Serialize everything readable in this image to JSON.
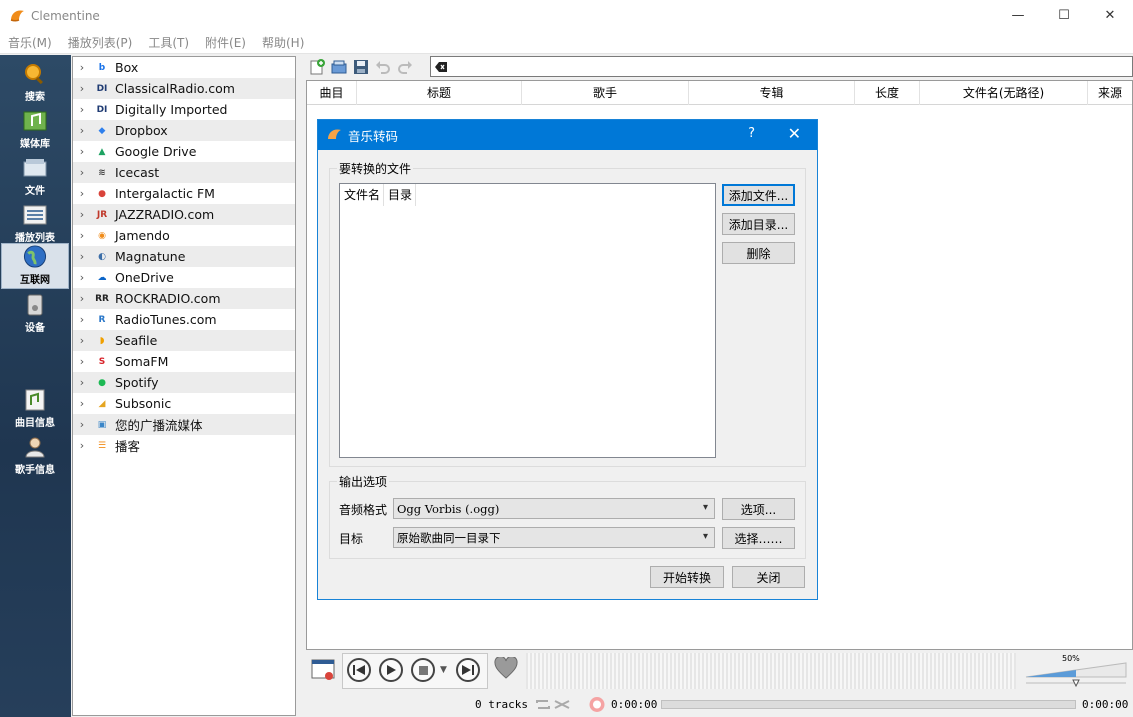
{
  "window": {
    "title": "Clementine",
    "minimize": "—",
    "maximize": "☐",
    "close": "✕"
  },
  "menu": [
    "音乐(M)",
    "播放列表(P)",
    "工具(T)",
    "附件(E)",
    "帮助(H)"
  ],
  "sidebar": [
    {
      "label": "搜索",
      "icon": "search-icon"
    },
    {
      "label": "媒体库",
      "icon": "library-icon"
    },
    {
      "label": "文件",
      "icon": "files-icon"
    },
    {
      "label": "播放列表",
      "icon": "playlists-icon"
    },
    {
      "label": "互联网",
      "icon": "internet-icon",
      "active": true
    },
    {
      "label": "设备",
      "icon": "devices-icon"
    },
    {
      "label": "曲目信息",
      "icon": "song-info-icon"
    },
    {
      "label": "歌手信息",
      "icon": "artist-info-icon"
    }
  ],
  "services": [
    {
      "label": "Box",
      "glyph": "b",
      "color": "#1a73e8"
    },
    {
      "label": "ClassicalRadio.com",
      "glyph": "DI",
      "color": "#1f3b73"
    },
    {
      "label": "Digitally Imported",
      "glyph": "DI",
      "color": "#1f3b73"
    },
    {
      "label": "Dropbox",
      "glyph": "◆",
      "color": "#2f80ed"
    },
    {
      "label": "Google Drive",
      "glyph": "▲",
      "color": "#1ea362"
    },
    {
      "label": "Icecast",
      "glyph": "≋",
      "color": "#444444"
    },
    {
      "label": "Intergalactic FM",
      "glyph": "●",
      "color": "#d9443b"
    },
    {
      "label": "JAZZRADIO.com",
      "glyph": "JR",
      "color": "#c0392b"
    },
    {
      "label": "Jamendo",
      "glyph": "◉",
      "color": "#f08c1a"
    },
    {
      "label": "Magnatune",
      "glyph": "◐",
      "color": "#3c6ea8"
    },
    {
      "label": "OneDrive",
      "glyph": "☁",
      "color": "#0a64c8"
    },
    {
      "label": "ROCKRADIO.com",
      "glyph": "RR",
      "color": "#222222"
    },
    {
      "label": "RadioTunes.com",
      "glyph": "R",
      "color": "#2a77c9"
    },
    {
      "label": "Seafile",
      "glyph": "◗",
      "color": "#f0a000"
    },
    {
      "label": "SomaFM",
      "glyph": "S",
      "color": "#d8232a"
    },
    {
      "label": "Spotify",
      "glyph": "●",
      "color": "#1db954"
    },
    {
      "label": "Subsonic",
      "glyph": "◢",
      "color": "#e5a520"
    },
    {
      "label": "您的广播流媒体",
      "glyph": "▣",
      "color": "#3a86c8"
    },
    {
      "label": "播客",
      "glyph": "☰",
      "color": "#f08c1a"
    }
  ],
  "playlist": {
    "columns": [
      "曲目",
      "标题",
      "歌手",
      "专辑",
      "长度",
      "文件名(无路径)",
      "来源"
    ]
  },
  "dialog": {
    "title": "音乐转码",
    "help": "?",
    "close": "✕",
    "files_group": "要转换的文件",
    "list_columns": [
      "文件名",
      "目录"
    ],
    "add_files": "添加文件...",
    "add_dir": "添加目录...",
    "remove": "删除",
    "output_group": "输出选项",
    "format_label": "音频格式",
    "format_value": "Ogg Vorbis (.ogg)",
    "options": "选项...",
    "dest_label": "目标",
    "dest_value": "原始歌曲同一目录下",
    "choose": "选择……",
    "start": "开始转换",
    "close_btn": "关闭"
  },
  "player": {
    "volume": "50%",
    "volume_fraction": 0.5,
    "tracks": "0 tracks",
    "elapsed": "0:00:00",
    "total": "0:00:00"
  }
}
